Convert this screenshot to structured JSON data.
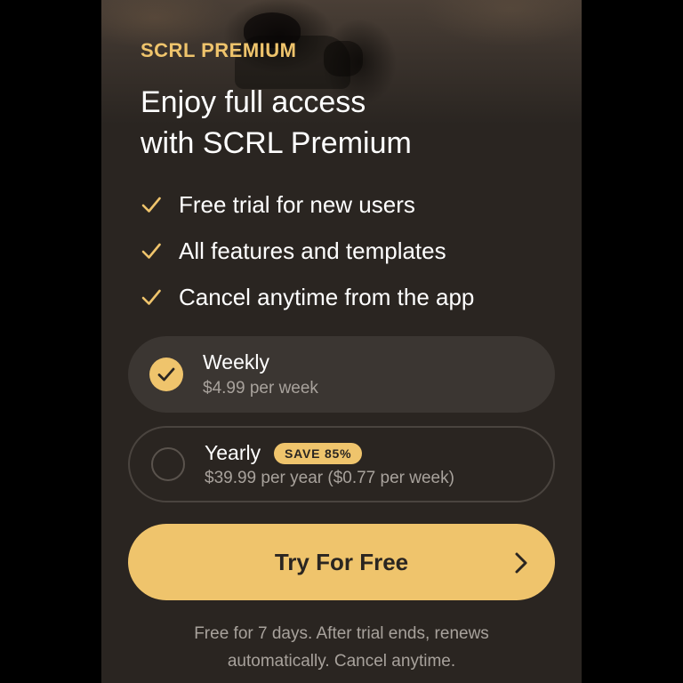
{
  "header": {
    "kicker": "SCRL PREMIUM",
    "title_line1": "Enjoy full access",
    "title_line2": "with SCRL Premium"
  },
  "features": [
    {
      "label": "Free trial for new users",
      "icon": "check-icon"
    },
    {
      "label": "All features and templates",
      "icon": "check-icon"
    },
    {
      "label": "Cancel anytime from the app",
      "icon": "check-icon"
    }
  ],
  "plans": [
    {
      "name": "Weekly",
      "price": "$4.99 per week",
      "selected": true
    },
    {
      "name": "Yearly",
      "price": "$39.99 per year ($0.77 per week)",
      "badge": "SAVE 85%",
      "selected": false
    }
  ],
  "cta": {
    "label": "Try For Free",
    "icon": "chevron-right-icon"
  },
  "footnote": {
    "line1": "Free for 7 days. After trial ends, renews",
    "line2": "automatically. Cancel anytime."
  },
  "colors": {
    "accent": "#efc46c",
    "background": "#2a2521",
    "card_selected": "#3b3632",
    "text_muted": "#a8a29c"
  }
}
